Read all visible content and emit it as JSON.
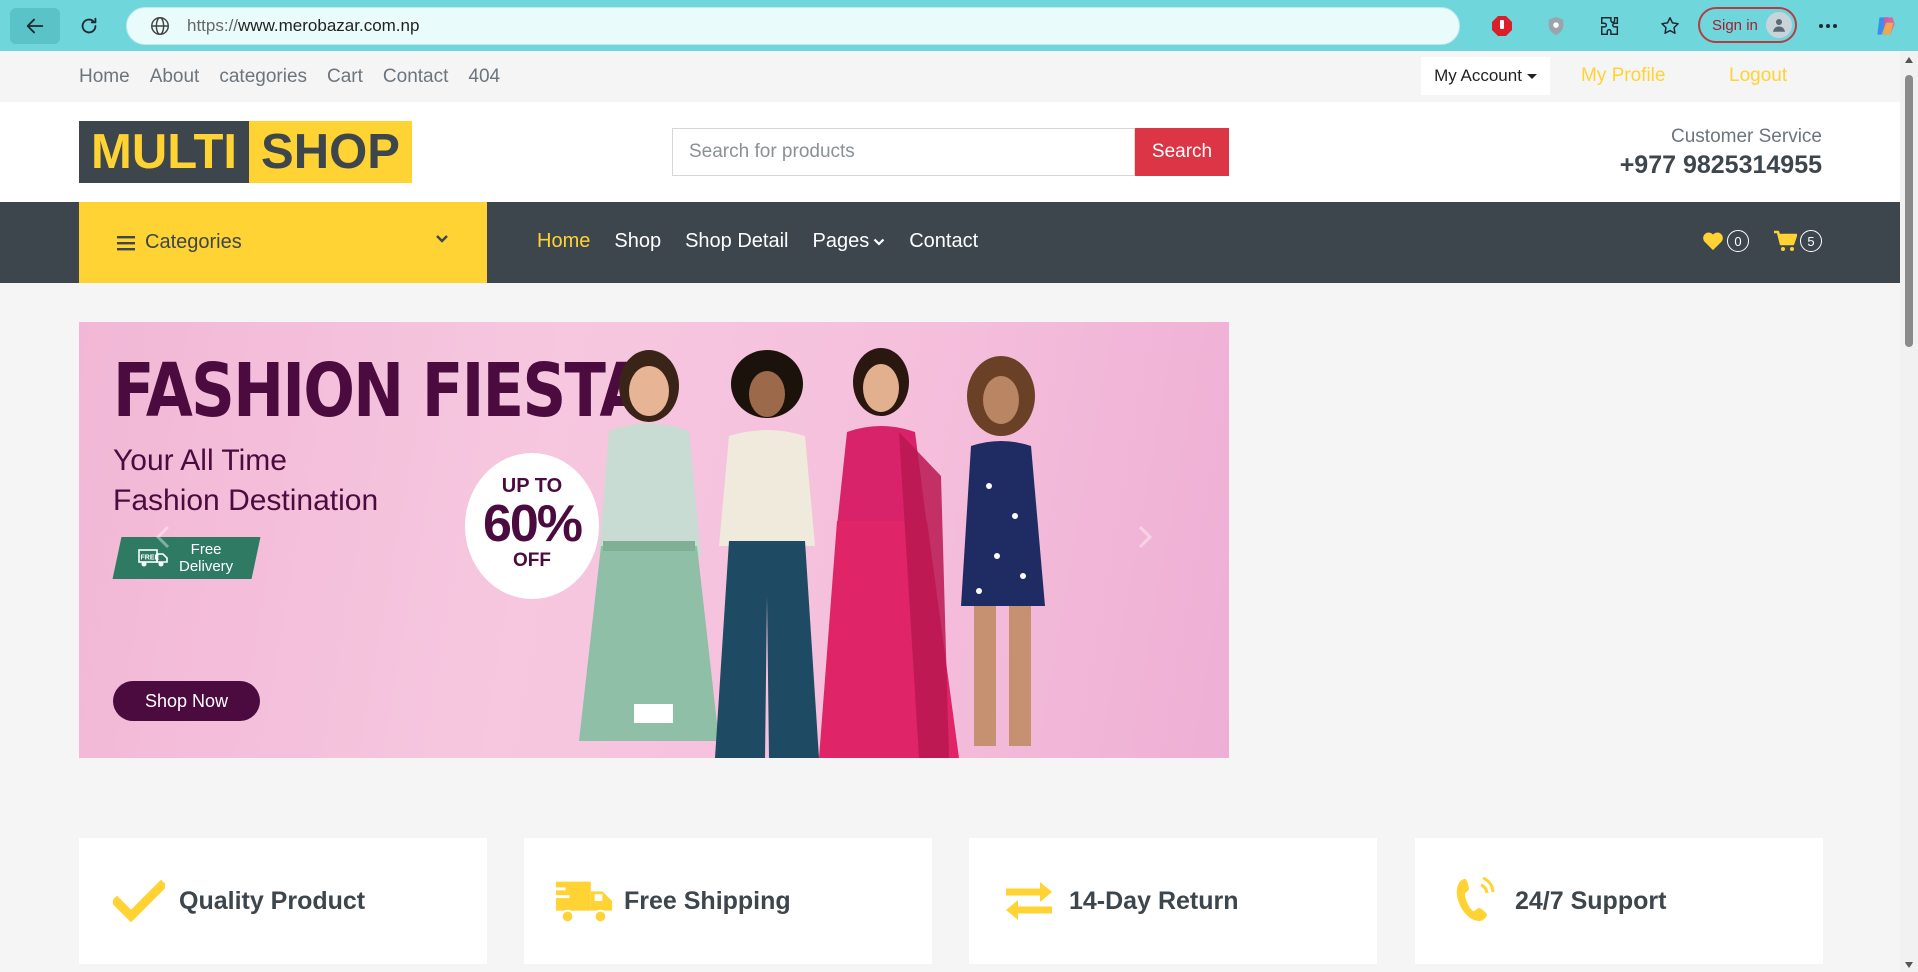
{
  "browser": {
    "url_protocol": "https://",
    "url_host": "www.merobazar.com.np",
    "signin_label": "Sign in"
  },
  "topbar": {
    "links": [
      "Home",
      "About",
      "categories",
      "Cart",
      "Contact",
      "404"
    ],
    "account_label": "My Account",
    "profile_label": "My Profile",
    "logout_label": "Logout"
  },
  "header": {
    "logo_part1": "MULTI",
    "logo_part2": "SHOP",
    "search_placeholder": "Search for products",
    "search_button": "Search",
    "customer_service_label": "Customer Service",
    "customer_service_phone": "+977 9825314955"
  },
  "navbar": {
    "categories_label": "Categories",
    "links": [
      "Home",
      "Shop",
      "Shop Detail",
      "Pages",
      "Contact"
    ],
    "active_link": "Home",
    "wishlist_count": "0",
    "cart_count": "5"
  },
  "banner": {
    "headline": "FASHION FIESTA",
    "sub_line1": "Your All Time",
    "sub_line2": "Fashion Destination",
    "free_text1": "Free",
    "free_text2": "Delivery",
    "free_truck_text": "FREE",
    "promo_up": "UP TO",
    "promo_pct": "60%",
    "promo_off": "OFF",
    "cta": "Shop Now"
  },
  "features": [
    {
      "label": "Quality Product",
      "icon": "check-icon"
    },
    {
      "label": "Free Shipping",
      "icon": "shipping-truck-icon"
    },
    {
      "label": "14-Day Return",
      "icon": "exchange-arrows-icon"
    },
    {
      "label": "24/7 Support",
      "icon": "phone-volume-icon"
    }
  ],
  "colors": {
    "primary_yellow": "#ffd333",
    "dark": "#3d464d",
    "search_red": "#dc3545",
    "browser_teal": "#6fd6dc"
  }
}
